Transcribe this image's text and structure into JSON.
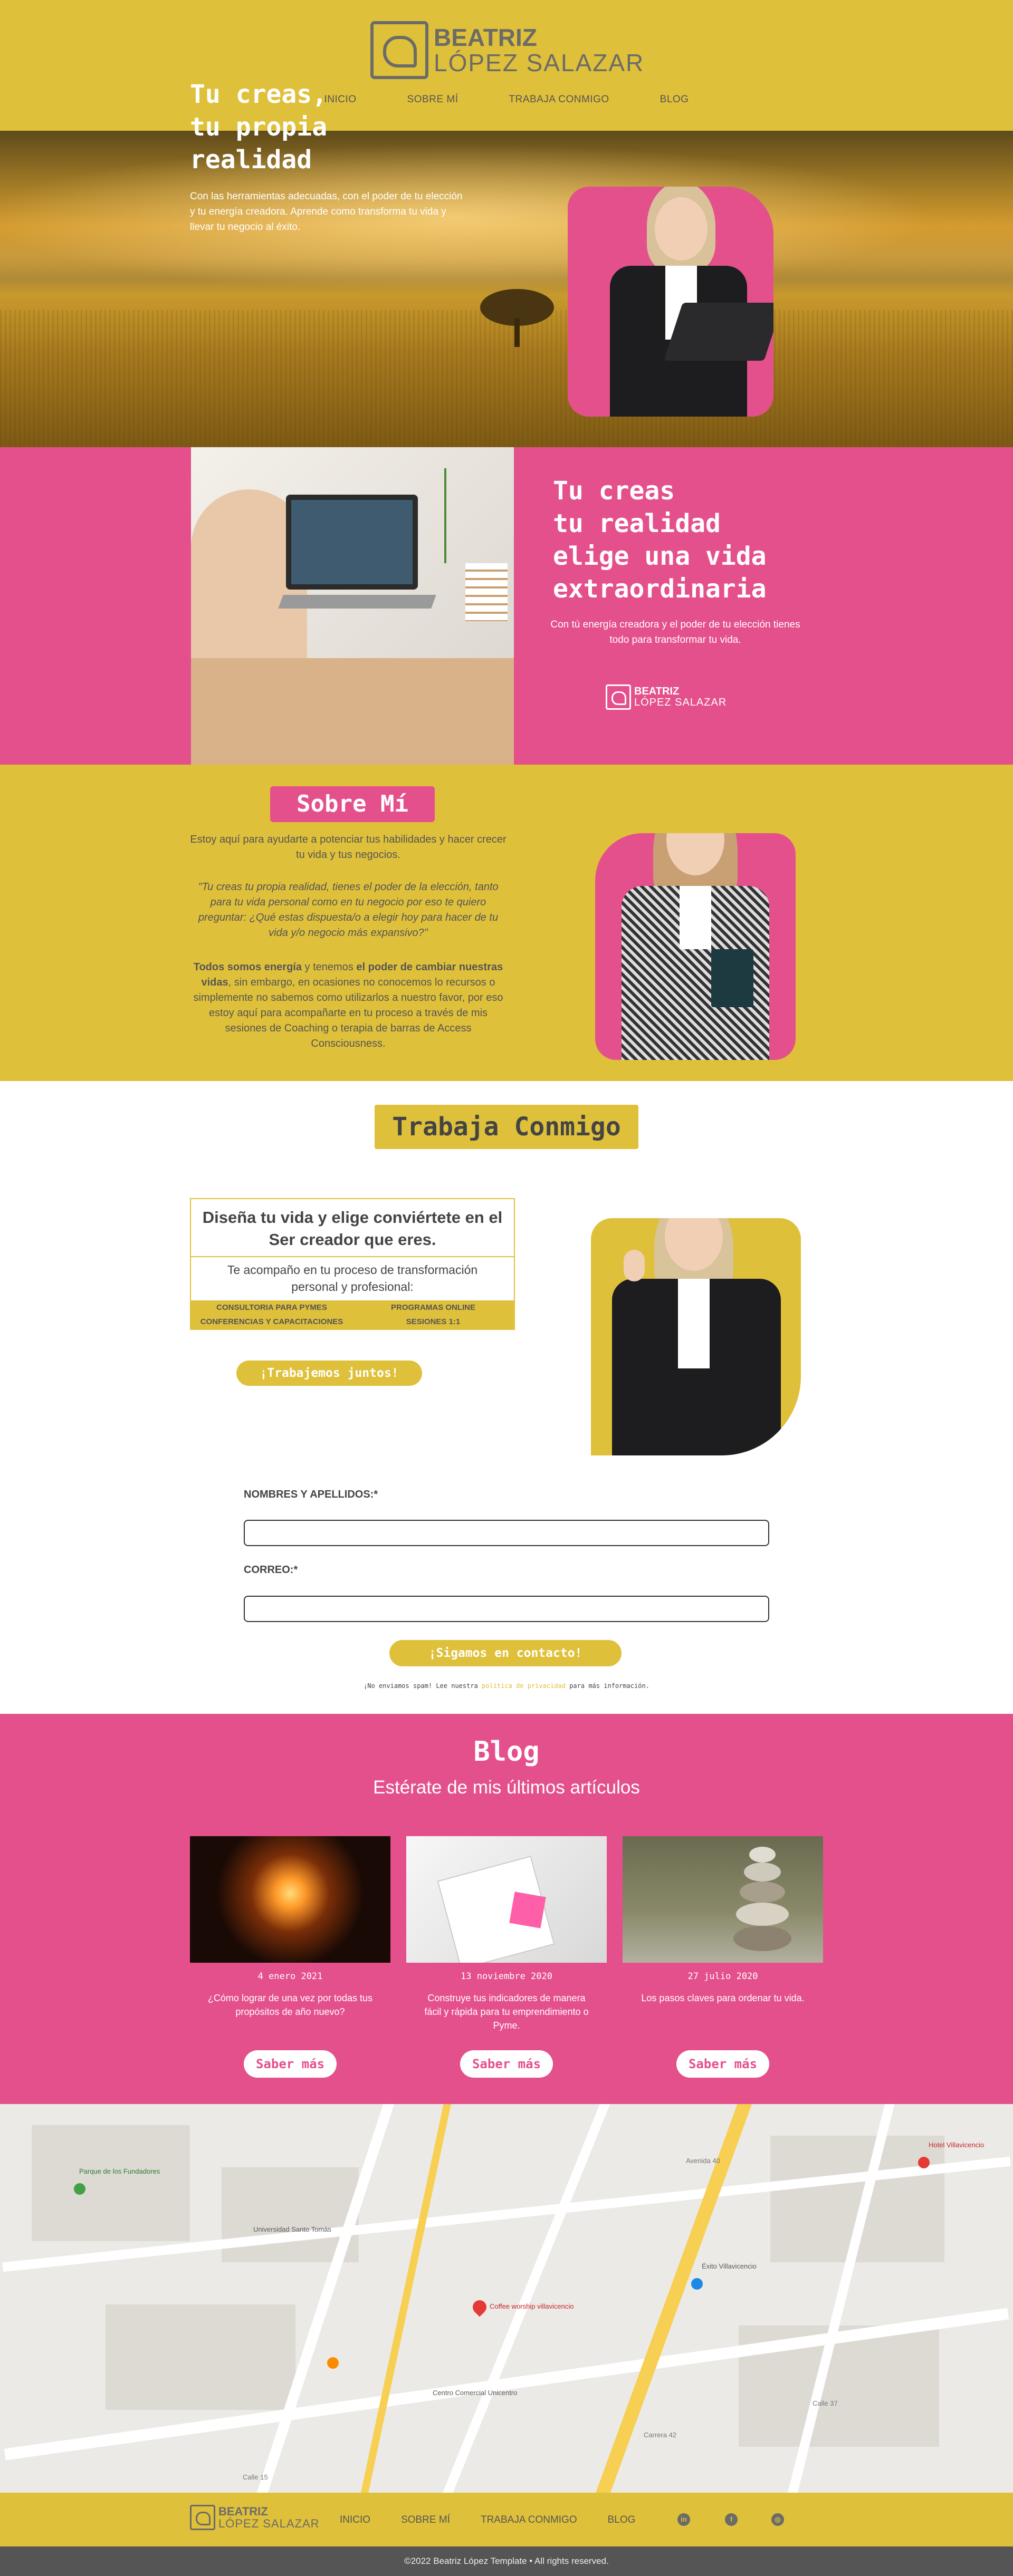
{
  "header": {
    "logo_line1": "BEATRIZ",
    "logo_line2": "LÓPEZ SALAZAR",
    "nav": [
      {
        "label": "INICIO"
      },
      {
        "label": "SOBRE MÍ"
      },
      {
        "label": "TRABAJA CONMIGO"
      },
      {
        "label": "BLOG"
      }
    ]
  },
  "hero": {
    "title": "Tu creas,\ntu propia\nrealidad",
    "subtitle": "Con las herramientas adecuadas, con el poder de tu elección y tu energía creadora. Aprende como transforma tu vida y llevar tu negocio al éxito."
  },
  "banner": {
    "title": "Tu creas\ntu realidad\nelige una vida\nextraordinaria",
    "subtitle": "Con tú energía creadora y el poder de tu elección tienes todo para transformar tu vida.",
    "logo_line1": "BEATRIZ",
    "logo_line2": "LÓPEZ SALAZAR"
  },
  "sobre": {
    "heading": "Sobre Mí",
    "intro": "Estoy aquí para ayudarte a potenciar tus habilidades y hacer crecer tu vida y tus negocios.",
    "quote": "\"Tu creas tu propia realidad, tienes el poder de la elección, tanto para tu vida personal como en tu negocio por eso te quiero preguntar: ¿Qué estas dispuesta/o a elegir hoy para hacer de tu vida y/o negocio más expansivo?\"",
    "body_bold1": "Todos somos energía",
    "body_mid": " y tenemos ",
    "body_bold2": "el poder de cambiar nuestras vidas",
    "body_rest": ", sin embargo, en ocasiones no conocemos lo recursos o simplemente no sabemos como utilizarlos a nuestro favor, por eso estoy aquí para acompañarte en tu proceso a través de mis sesiones de Coaching o terapia de barras de Access Consciousness."
  },
  "trabaja": {
    "heading": "Trabaja Conmigo",
    "box_title": "Diseña tu vida y elige conviértete en el Ser creador que eres.",
    "box_sub": "Te acompaño en tu proceso de transformación personal y profesional:",
    "services": [
      "CONSULTORIA PARA PYMES",
      "PROGRAMAS ONLINE",
      "CONFERENCIAS Y CAPACITACIONES",
      "SESIONES 1:1"
    ],
    "cta": "¡Trabajemos juntos!",
    "form": {
      "name_label": "NOMBRES Y APELLIDOS:*",
      "email_label": "CORREO:*",
      "name_value": "",
      "email_value": "",
      "submit": "¡Sigamos en contacto!",
      "note_before": "¡No enviamos spam! Lee nuestra ",
      "note_link": "política de privacidad",
      "note_after": " para más información."
    }
  },
  "blog": {
    "heading": "Blog",
    "subtitle": "Estérate de mis últimos artículos",
    "posts": [
      {
        "date": "4 enero 2021",
        "title": "¿Cómo lograr de una vez por todas tus propósitos de año nuevo?",
        "cta": "Saber más"
      },
      {
        "date": "13 noviembre 2020",
        "title": "Construye tus indicadores de manera fácil y rápida para tu emprendimiento o Pyme.",
        "cta": "Saber más"
      },
      {
        "date": "27 julio 2020",
        "title": "Los pasos claves para ordenar tu vida.",
        "cta": "Saber más"
      }
    ]
  },
  "map": {
    "labels": [
      "Centro Comercial Unicentro",
      "Parque de los Fundadores",
      "Coffee worship villavicencio",
      "Hotel Villavicencio",
      "Éxito Villavicencio",
      "Universidad Santo Tomás",
      "Calle 15",
      "Carrera 42",
      "Avenida 40",
      "Calle 37"
    ]
  },
  "footer": {
    "logo_line1": "BEATRIZ",
    "logo_line2": "LÓPEZ SALAZAR",
    "nav": [
      {
        "label": "INICIO"
      },
      {
        "label": "SOBRE MÍ"
      },
      {
        "label": "TRABAJA CONMIGO"
      },
      {
        "label": "BLOG"
      }
    ],
    "social": [
      "in",
      "f",
      "◎"
    ],
    "copyright": "©2022 Beatriz López Template • All rights reserved."
  },
  "colors": {
    "yellow": "#dfc03a",
    "pink": "#e4508b",
    "gray": "#6b6b68"
  }
}
